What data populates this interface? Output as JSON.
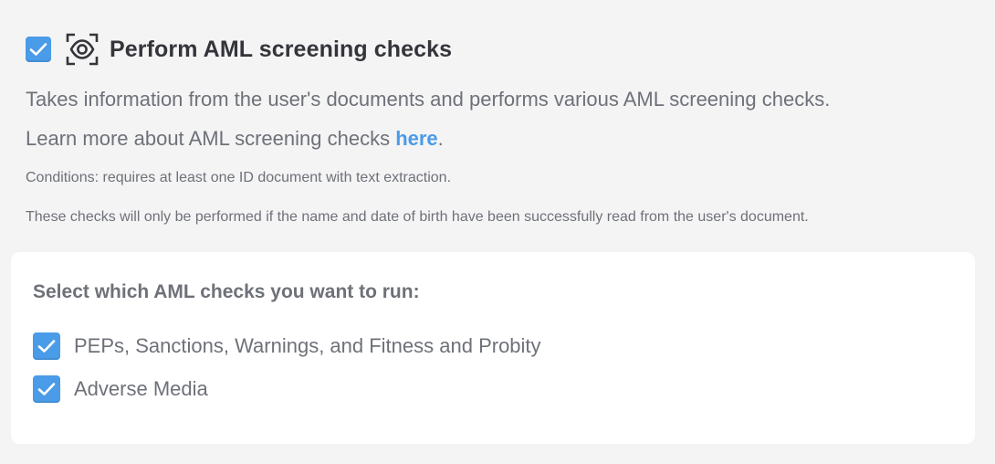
{
  "header": {
    "enabled": true,
    "title": "Perform AML screening checks",
    "icon": "eye-scan-icon"
  },
  "description": {
    "line1": "Takes information from the user's documents and performs various AML screening checks.",
    "line2_prefix": "Learn more about AML screening checks ",
    "line2_link": "here",
    "line2_suffix": "."
  },
  "notes": {
    "conditions": "Conditions: requires at least one ID document with text extraction.",
    "performed_if": "These checks will only be performed if the name and date of birth have been successfully read from the user's document."
  },
  "selection_card": {
    "title": "Select which AML checks you want to run:",
    "options": [
      {
        "label": "PEPs, Sanctions, Warnings, and Fitness and Probity",
        "checked": true
      },
      {
        "label": "Adverse Media",
        "checked": true
      }
    ]
  },
  "colors": {
    "accent": "#4a9be8",
    "background": "#f4f4f5",
    "card": "#ffffff",
    "title_text": "#34353a",
    "body_text": "#6e7178"
  }
}
